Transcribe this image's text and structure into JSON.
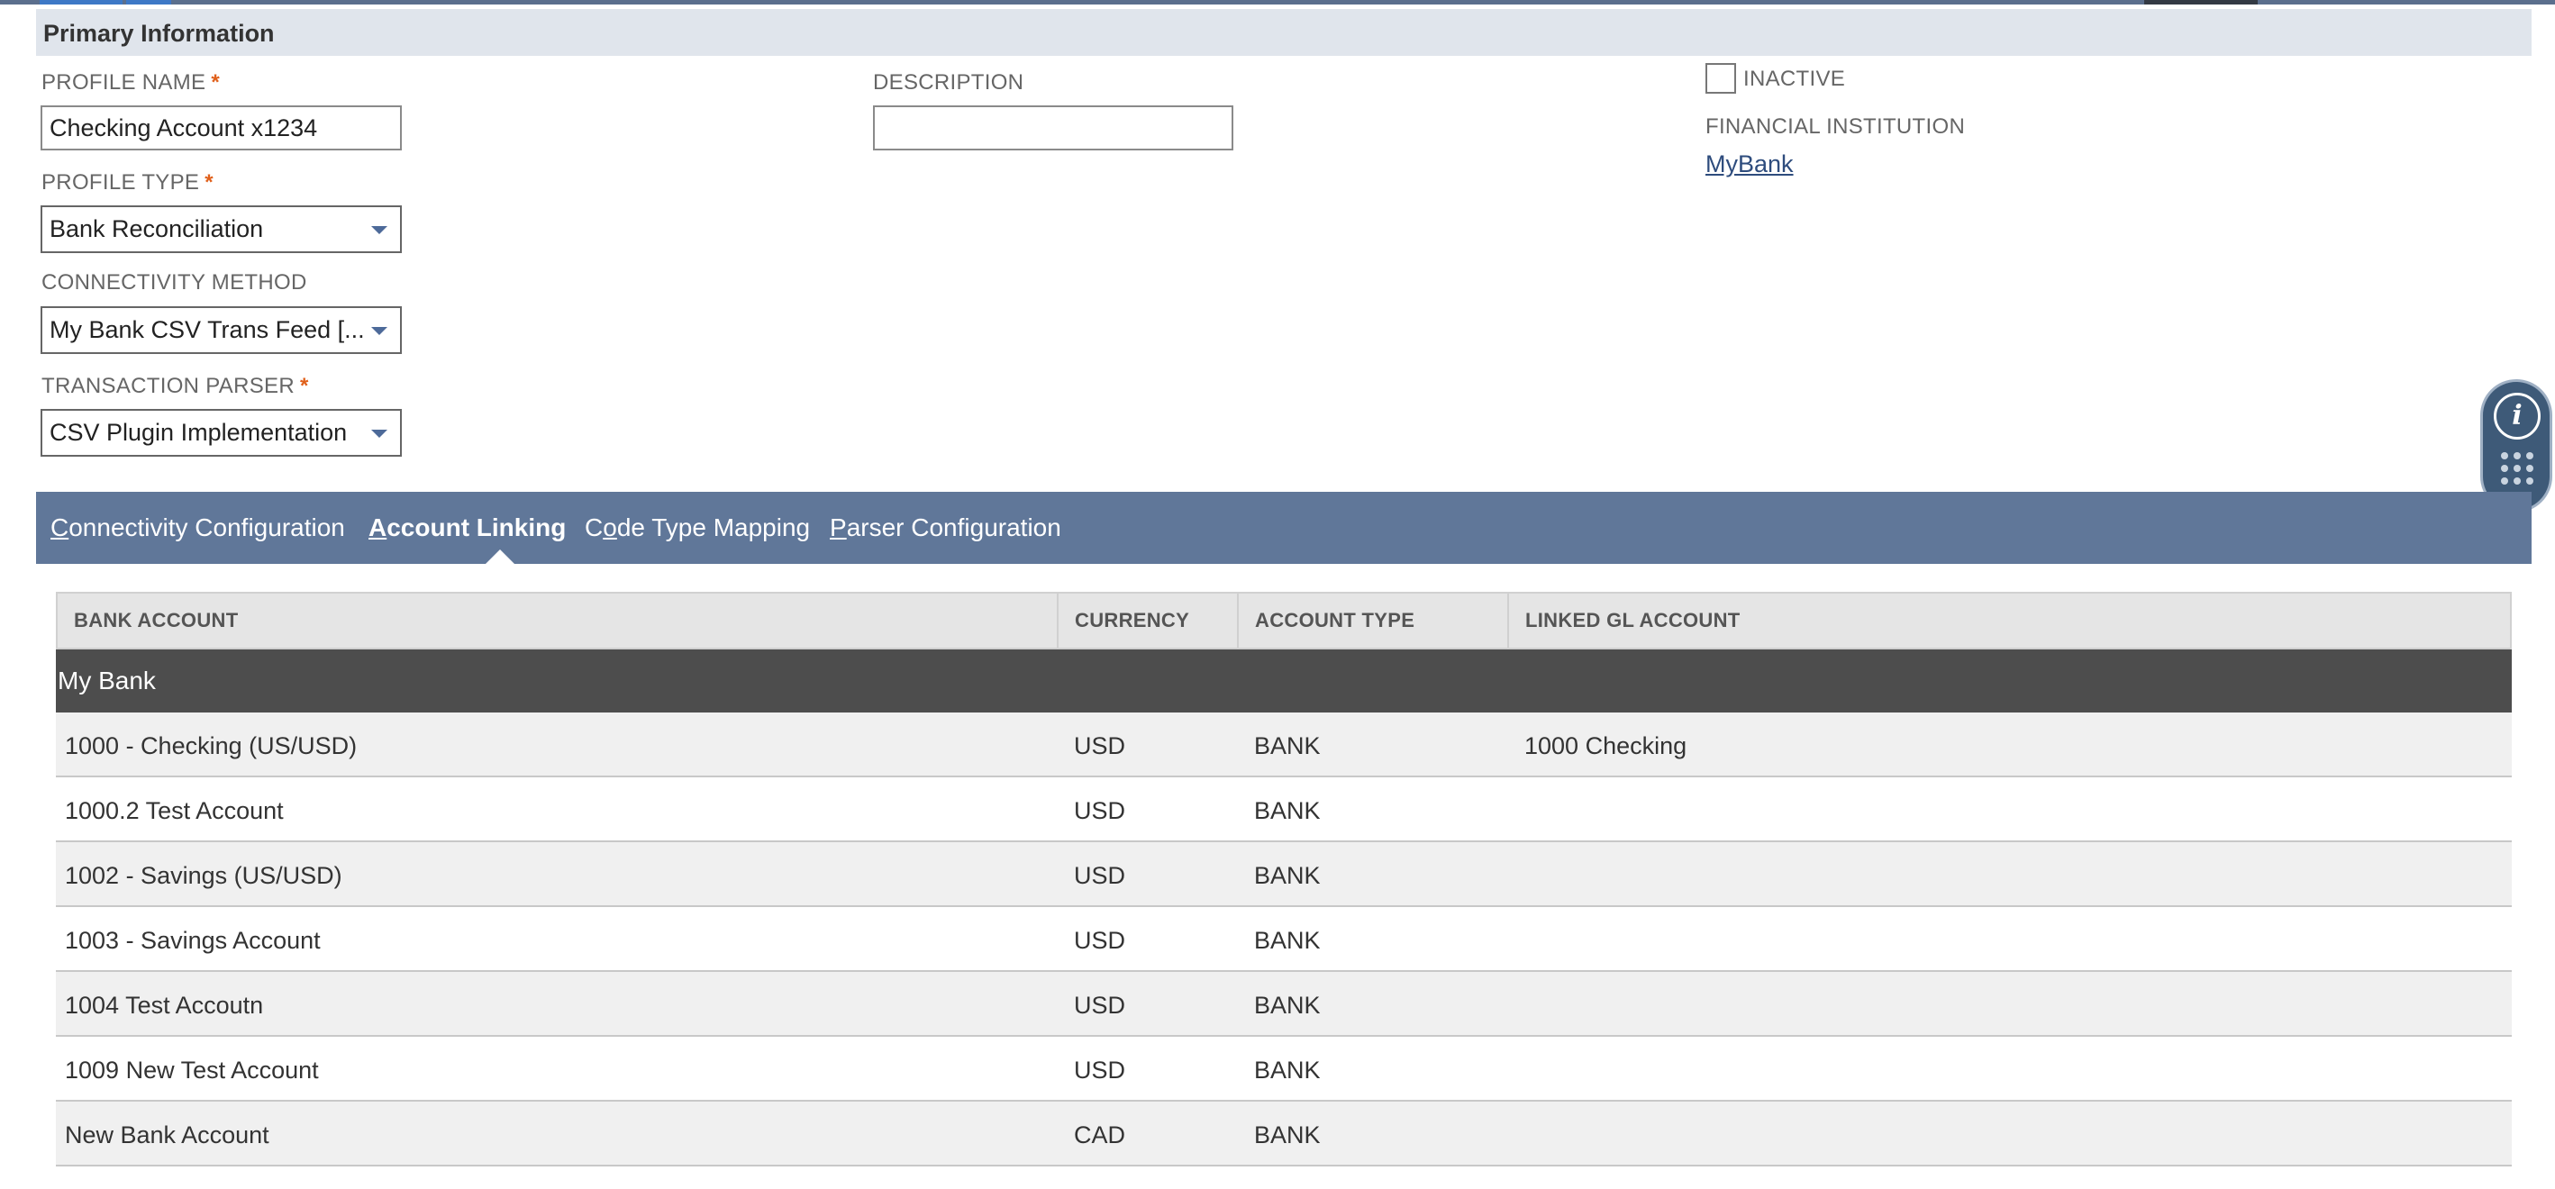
{
  "primary_info": {
    "section_title": "Primary Information",
    "profile_name": {
      "label": "PROFILE NAME",
      "required": "*",
      "value": "Checking Account x1234"
    },
    "description": {
      "label": "DESCRIPTION",
      "value": ""
    },
    "profile_type": {
      "label": "PROFILE TYPE",
      "required": "*",
      "value": "Bank Reconciliation"
    },
    "connectivity_method": {
      "label": "CONNECTIVITY METHOD",
      "value": "My Bank CSV Trans Feed [..."
    },
    "transaction_parser": {
      "label": "TRANSACTION PARSER",
      "required": "*",
      "value": "CSV Plugin Implementation"
    },
    "inactive": {
      "label": "INACTIVE",
      "checked": false
    },
    "financial_institution": {
      "label": "FINANCIAL INSTITUTION",
      "value": "MyBank"
    }
  },
  "tabs": [
    {
      "accesskey": "C",
      "rest": "onnectivity Configuration",
      "active": false
    },
    {
      "accesskey": "A",
      "rest": "ccount Linking",
      "active": true
    },
    {
      "pre": "C",
      "accesskey": "o",
      "rest": "de Type Mapping",
      "active": false
    },
    {
      "accesskey": "P",
      "rest": "arser Configuration",
      "active": false
    }
  ],
  "table": {
    "columns": [
      "BANK ACCOUNT",
      "CURRENCY",
      "ACCOUNT TYPE",
      "LINKED GL ACCOUNT"
    ],
    "group": "My Bank",
    "rows": [
      {
        "bank_account": "1000 - Checking (US/USD)",
        "currency": "USD",
        "account_type": "BANK",
        "linked_gl": "1000 Checking"
      },
      {
        "bank_account": "1000.2 Test Account",
        "currency": "USD",
        "account_type": "BANK",
        "linked_gl": ""
      },
      {
        "bank_account": "1002 - Savings (US/USD)",
        "currency": "USD",
        "account_type": "BANK",
        "linked_gl": ""
      },
      {
        "bank_account": "1003 - Savings Account",
        "currency": "USD",
        "account_type": "BANK",
        "linked_gl": ""
      },
      {
        "bank_account": "1004 Test Accoutn",
        "currency": "USD",
        "account_type": "BANK",
        "linked_gl": ""
      },
      {
        "bank_account": "1009 New Test Account",
        "currency": "USD",
        "account_type": "BANK",
        "linked_gl": ""
      },
      {
        "bank_account": "New Bank Account",
        "currency": "CAD",
        "account_type": "BANK",
        "linked_gl": ""
      }
    ]
  },
  "side_widget": {
    "info_icon": "info-icon",
    "grid_icon": "dots-grid-icon"
  },
  "colors": {
    "tab_bar": "#607799",
    "section_header_bg": "#e0e5ec",
    "group_row_bg": "#4d4d4d",
    "required_mark": "#e0601b",
    "link": "#2e4c7d"
  }
}
